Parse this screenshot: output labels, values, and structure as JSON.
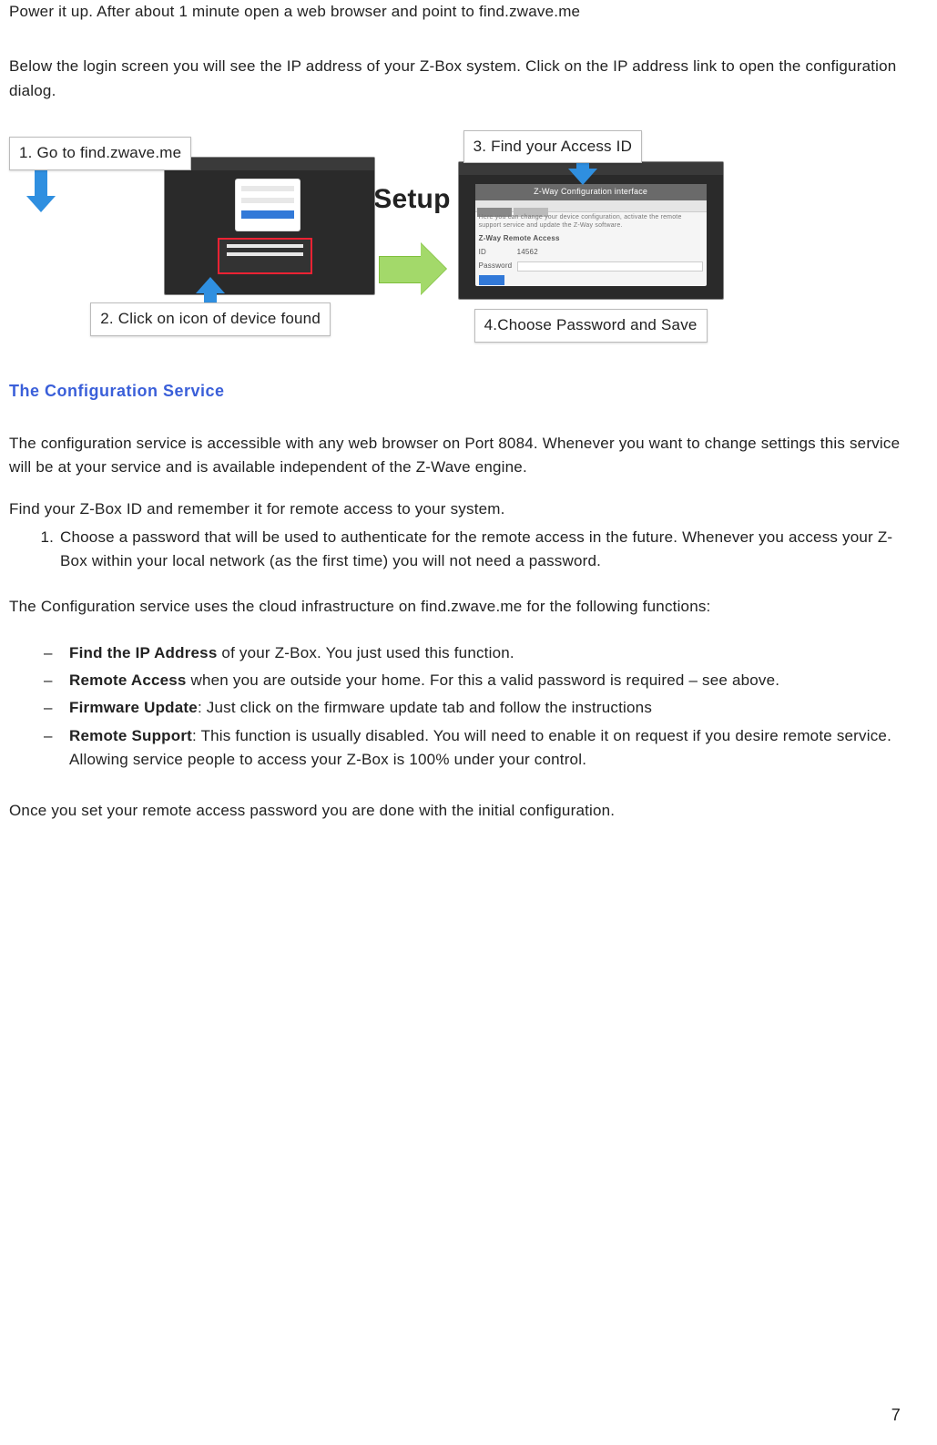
{
  "intro": {
    "p1": "Power it up. After about 1 minute open a web browser and point to find.zwave.me",
    "p2": "Below the login screen you will see the IP address of your Z-Box system. Click on the IP address link to open the configuration dialog."
  },
  "diagram": {
    "setup_label": "Setup",
    "caption1": "1. Go to find.zwave.me",
    "caption2": "2. Click on icon of device found",
    "caption3": "3. Find your Access ID",
    "caption4": "4.Choose Password and Save",
    "dialog_title": "Z-Way Configuration interface",
    "dialog_section": "Z-Way Remote Access",
    "dialog_pwd_label": "Password",
    "dialog_id_label": "ID"
  },
  "section": {
    "heading": "The Configuration Service",
    "p1": "The configuration service is accessible with any web browser on Port 8084. Whenever you want to change settings this service will be at your service and is available independent of the Z-Wave engine.",
    "p2": "Find your Z-Box ID and remember it for remote access to your system.",
    "ol1": "Choose a password that will be used to authenticate for the remote access in the future. Whenever you access your Z-Box within your local network (as the first time) you will not need a password.",
    "p3": "The Configuration service uses the cloud infrastructure on find.zwave.me for the following functions:",
    "bullet1_bold": "Find the IP Address",
    "bullet1_rest": " of your Z-Box. You just used this function.",
    "bullet2_bold": "Remote Access",
    "bullet2_rest": " when you are outside your home. For this a valid password is required – see above.",
    "bullet3_bold": "Firmware Update",
    "bullet3_rest": ": Just click on the firmware update tab and follow the instructions",
    "bullet4_bold": "Remote Support",
    "bullet4_rest": ": This function is usually disabled. You will need to enable it on request if you desire remote service. Allowing service people to access your Z-Box is 100% under your control.",
    "p4": "Once you set your remote access password you are done with the initial configuration."
  },
  "page_number": "7"
}
